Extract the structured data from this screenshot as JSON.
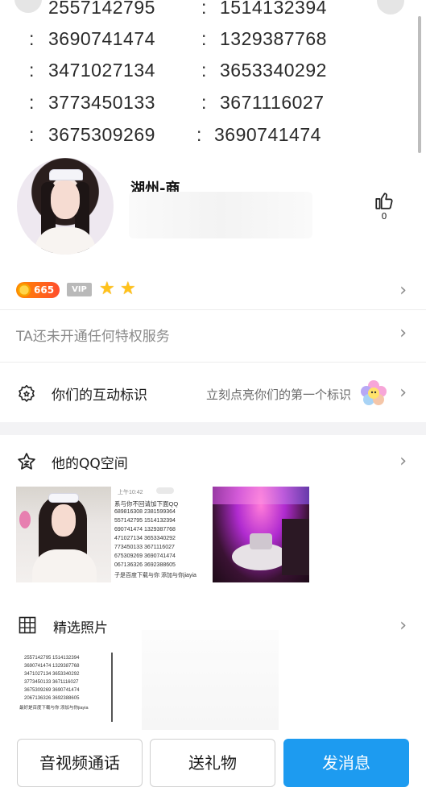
{
  "number_list": [
    [
      "2557142795",
      "1514132394"
    ],
    [
      "3690741474",
      "1329387768"
    ],
    [
      "3471027134",
      "3653340292"
    ],
    [
      "3773450133",
      "3671116027"
    ],
    [
      "3675309269",
      "3690741474"
    ]
  ],
  "number_separator": ":",
  "profile": {
    "nickname": "湖州-商",
    "like_count": "0"
  },
  "badges": {
    "coin_level": "665",
    "vip_label": "VIP",
    "star_count": 2
  },
  "privilege": {
    "text": "TA还未开通任何特权服务"
  },
  "interaction": {
    "label": "你们的互动标识",
    "hint": "立刻点亮你们的第一个标识"
  },
  "qzone": {
    "label": "他的QQ空间",
    "thumb2_lines": [
      "上午10:42",
      "系与你不回请加下面QQ",
      "689816308    2381599364",
      "557142795    1514132394",
      "690741474    1329387768",
      "471027134    3653340292",
      "773450133    3671116027",
      "675309269    3690741474",
      "067136326    3692388605",
      "子是百度下载与你  添加与你jiayia"
    ]
  },
  "featured": {
    "label": "精选照片",
    "thumb_lines": [
      "2557142795    1514132394",
      "3690741474    1329387768",
      "3471027134    3653340292",
      "3773450133    3671116027",
      "3675309269    3690741474",
      "2067136326    3692388605",
      "最好是百度下载与你  添加与你jiayia"
    ]
  },
  "actions": {
    "av_call": "音视频通话",
    "gift": "送礼物",
    "message": "发消息"
  },
  "colors": {
    "primary_button": "#1d9bf0",
    "coin_badge": "#ff6a1a",
    "vip_gray": "#b9b9b9",
    "star": "#ffc21a"
  }
}
